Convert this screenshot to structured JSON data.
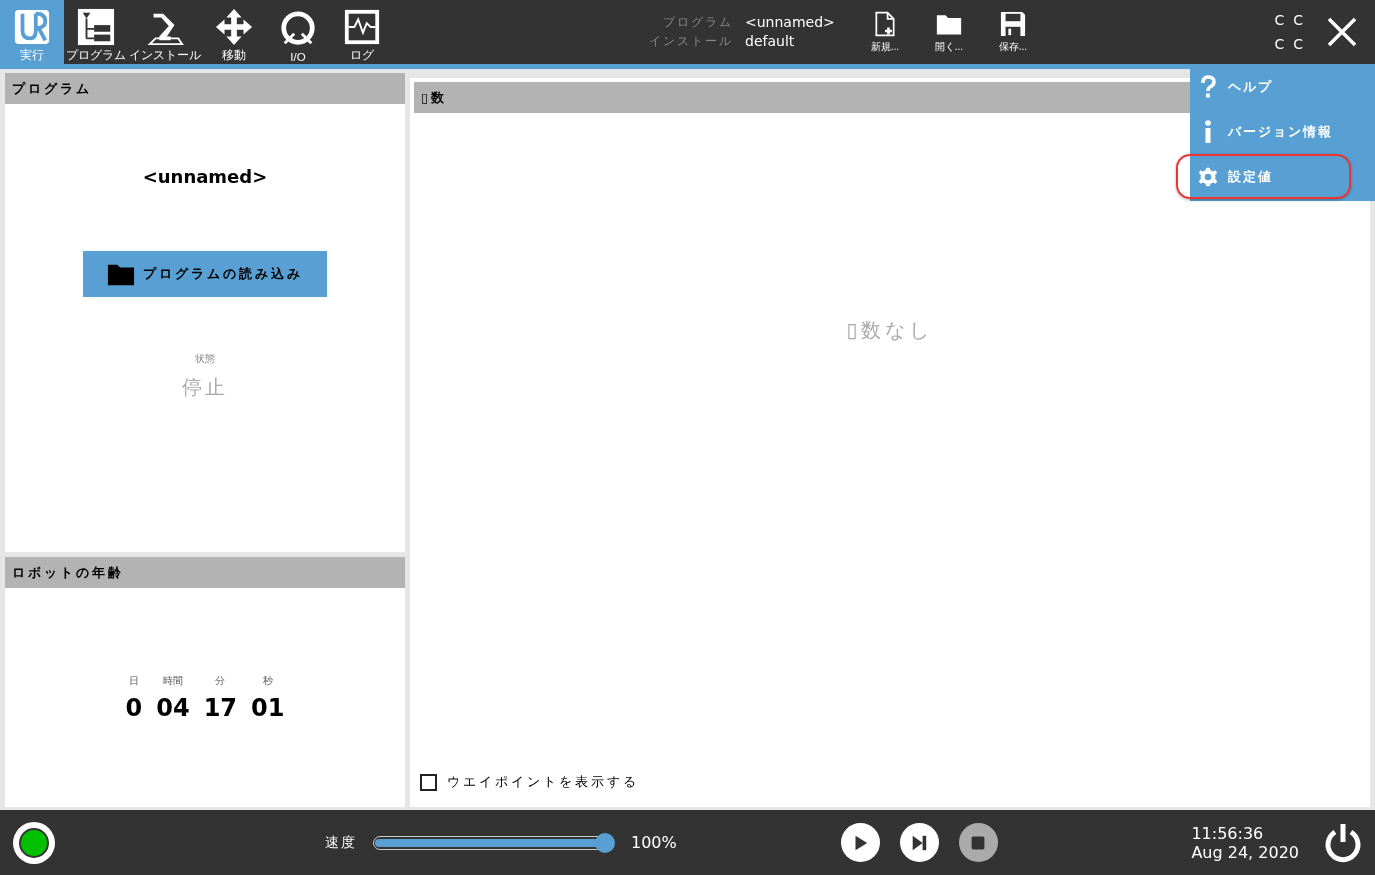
{
  "nav_tabs": [
    {
      "label": "実行",
      "selected": true
    },
    {
      "label": "プログラム",
      "selected": false
    },
    {
      "label": "インストール",
      "selected": false
    },
    {
      "label": "移動",
      "selected": false
    },
    {
      "label": "I/O",
      "selected": false
    },
    {
      "label": "ログ",
      "selected": false
    }
  ],
  "file_info": {
    "program_label": "プログラム",
    "program_value": "<unnamed>",
    "installation_label": "インストール",
    "installation_value": "default"
  },
  "file_buttons": [
    {
      "label": "新規..."
    },
    {
      "label": "開く..."
    },
    {
      "label": "保存..."
    }
  ],
  "corner_glyphs": [
    "C  C",
    "C  C"
  ],
  "menu": [
    {
      "label": "ヘルプ",
      "highlighted": false
    },
    {
      "label": "バージョン情報",
      "highlighted": false
    },
    {
      "label": "設定値",
      "highlighted": true
    }
  ],
  "program_panel": {
    "title": "プログラム",
    "program_name": "<unnamed>",
    "load_button": "プログラムの読み込み",
    "status_label": "状態",
    "status_value": "停止"
  },
  "robot_age_panel": {
    "title": "ロボットの年齢",
    "units": [
      {
        "label": "日",
        "value": "0"
      },
      {
        "label": "時間",
        "value": "04"
      },
      {
        "label": "分",
        "value": "17"
      },
      {
        "label": "秒",
        "value": "01"
      }
    ]
  },
  "variables_panel": {
    "title": "▯数",
    "empty_message": "▯数なし",
    "show_waypoints": {
      "label": "ウエイポイントを表示する",
      "checked": false
    }
  },
  "footer": {
    "speed_label": "速度",
    "speed": {
      "level": 1.0
    },
    "speed_reading": "100%",
    "controls": [
      {
        "kind": "play",
        "disabled": false
      },
      {
        "kind": "step",
        "disabled": false
      },
      {
        "kind": "stop",
        "disabled": true
      }
    ],
    "time": "11:56:36",
    "date": "Aug 24, 2020"
  }
}
